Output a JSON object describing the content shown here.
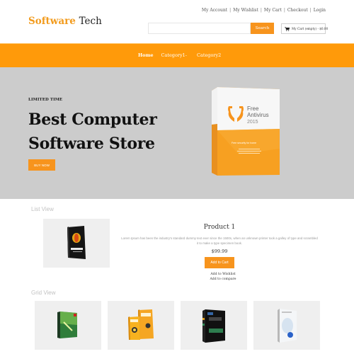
{
  "header": {
    "logo_primary": "Software",
    "logo_secondary": "Tech",
    "top_links": [
      "My Account",
      "My Wishlist",
      "My Cart",
      "Checkout",
      "Login"
    ],
    "search": {
      "placeholder": "",
      "value": "",
      "button_label": "Search"
    },
    "cart": {
      "label": "My Cart (empty) - $0.00",
      "icon": "cart-icon"
    }
  },
  "nav": {
    "items": [
      {
        "label": "Home"
      },
      {
        "label": "Category1-"
      },
      {
        "label": "Category2"
      }
    ]
  },
  "hero": {
    "kicker": "LIMITED TIME",
    "title_line1": "Best Computer",
    "title_line2": "Software Store",
    "button_label": "BUY NOW",
    "product_image": {
      "title_line1": "Free",
      "title_line2": "Antivirus",
      "year": "2015",
      "tagline": "Free security for home"
    }
  },
  "list_view": {
    "label": "List View",
    "product": {
      "image_label": "CorelDRAW",
      "title": "Product 1",
      "description": "Lorem Ipsum has been the industry's standard dummy text ever since the 1500s, when an unknown printer took a galley of type and scrambled it to make a type specimen book.",
      "price": "$99.99",
      "add_to_cart": "Add to Cart",
      "add_to_wishlist": "Add to Wishlist",
      "add_to_compare": "Add to compare"
    }
  },
  "grid_view": {
    "label": "Grid View",
    "items": [
      {
        "image_label": "green software box"
      },
      {
        "image_label": "Norton"
      },
      {
        "image_label": "AVG AntiVirus"
      },
      {
        "image_label": "white software box"
      }
    ]
  },
  "colors": {
    "accent": "#f7941d",
    "nav_bg": "#ff9a0a",
    "hero_bg": "#cccccc",
    "card_bg": "#efefef"
  }
}
